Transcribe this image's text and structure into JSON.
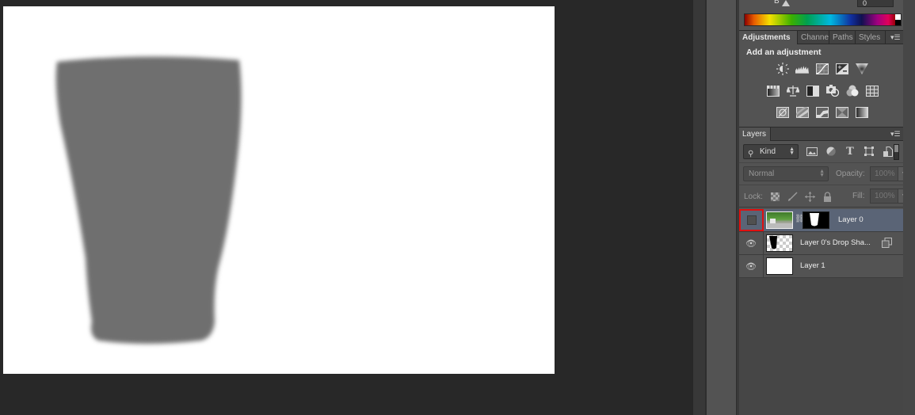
{
  "canvas": {
    "document_background": "#ffffff",
    "shape_color": "#6f6f6f",
    "shape_description": "blurred gray cup silhouette"
  },
  "color_panel": {
    "channel_label": "B",
    "channel_value": "0"
  },
  "adjustments_panel": {
    "tabs": [
      {
        "label": "Adjustments",
        "active": true
      },
      {
        "label": "Channels",
        "active": false
      },
      {
        "label": "Paths",
        "active": false
      },
      {
        "label": "Styles",
        "active": false
      }
    ],
    "menu_icon": "panel-menu-icon",
    "title": "Add an adjustment",
    "rows": [
      [
        "brightness-contrast-icon",
        "levels-icon",
        "curves-icon",
        "exposure-icon",
        "vibrance-icon"
      ],
      [
        "hue-saturation-icon",
        "color-balance-icon",
        "black-white-icon",
        "photo-filter-icon",
        "channel-mixer-icon",
        "color-lookup-icon"
      ],
      [
        "invert-icon",
        "posterize-icon",
        "threshold-icon",
        "selective-color-icon",
        "gradient-map-icon"
      ]
    ]
  },
  "layers_panel": {
    "tab": "Layers",
    "filter": {
      "kind_label": "Kind",
      "icons": [
        "pixel-filter-icon",
        "adjustment-filter-icon",
        "type-filter-icon",
        "shape-filter-icon",
        "smart-object-filter-icon"
      ]
    },
    "blend_mode": "Normal",
    "opacity_label": "Opacity:",
    "opacity_value": "100%",
    "lock_label": "Lock:",
    "lock_icons": [
      "lock-transparent-icon",
      "lock-image-icon",
      "lock-position-icon",
      "lock-all-icon"
    ],
    "fill_label": "Fill:",
    "fill_value": "100%",
    "layers": [
      {
        "name": "Layer 0",
        "visible": false,
        "selected": true,
        "has_mask": true
      },
      {
        "name": "Layer 0's Drop Sha...",
        "visible": true,
        "selected": false,
        "has_mask": false,
        "badge": "smart-object-icon"
      },
      {
        "name": "Layer 1",
        "visible": true,
        "selected": false,
        "has_mask": false
      }
    ]
  }
}
